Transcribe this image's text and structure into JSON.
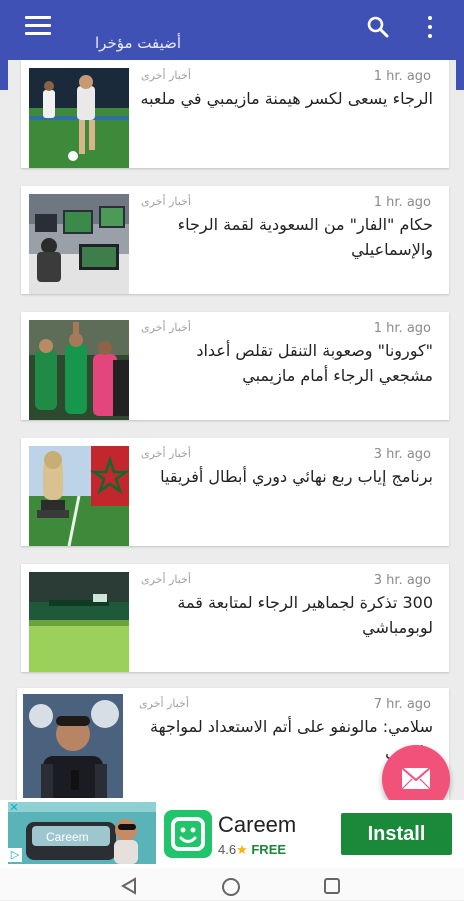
{
  "appbar": {
    "title": "أضيفت مؤخرا",
    "menu_icon": "hamburger-menu-icon",
    "search_icon": "search-icon",
    "more_icon": "more-vert-icon",
    "color": "#3f51b5"
  },
  "articles": [
    {
      "source": "أخبار أخرى",
      "time": "1 hr. ago",
      "headline": "الرجاء يسعى لكسر هيمنة مازيمبي في ملعبه"
    },
    {
      "source": "أخبار أخرى",
      "time": "1 hr. ago",
      "headline": "حكام \"الفار\" من السعودية لقمة الرجاء والإسماعيلي"
    },
    {
      "source": "أخبار أخرى",
      "time": "1 hr. ago",
      "headline": "\"كورونا\" وصعوبة التنقل تقلص أعداد مشجعي الرجاء أمام مازيمبي"
    },
    {
      "source": "أخبار أخرى",
      "time": "3 hr. ago",
      "headline": "برنامج إياب ربع نهائي دوري أبطال أفريقيا"
    },
    {
      "source": "أخبار أخرى",
      "time": "3 hr. ago",
      "headline": "300 تذكرة لجماهير الرجاء لمتابعة قمة لوبومباشي"
    },
    {
      "source": "أخبار أخرى",
      "time": "7 hr. ago",
      "headline": "سلامي: مالونفو على أتم الاستعداد لمواجهة مازمبي"
    }
  ],
  "fab": {
    "icon": "mail-icon",
    "color": "#f0527a"
  },
  "ad": {
    "image_text": "Careem",
    "app_name": "Careem",
    "rating": "4.6",
    "rating_star": "★",
    "price": "FREE",
    "install_label": "Install",
    "info_icon": "ad-info-icon",
    "close_icon": "ad-close-icon"
  },
  "navbar": {
    "back_icon": "back-triangle-icon",
    "home_icon": "home-circle-icon",
    "recents_icon": "recents-square-icon"
  }
}
